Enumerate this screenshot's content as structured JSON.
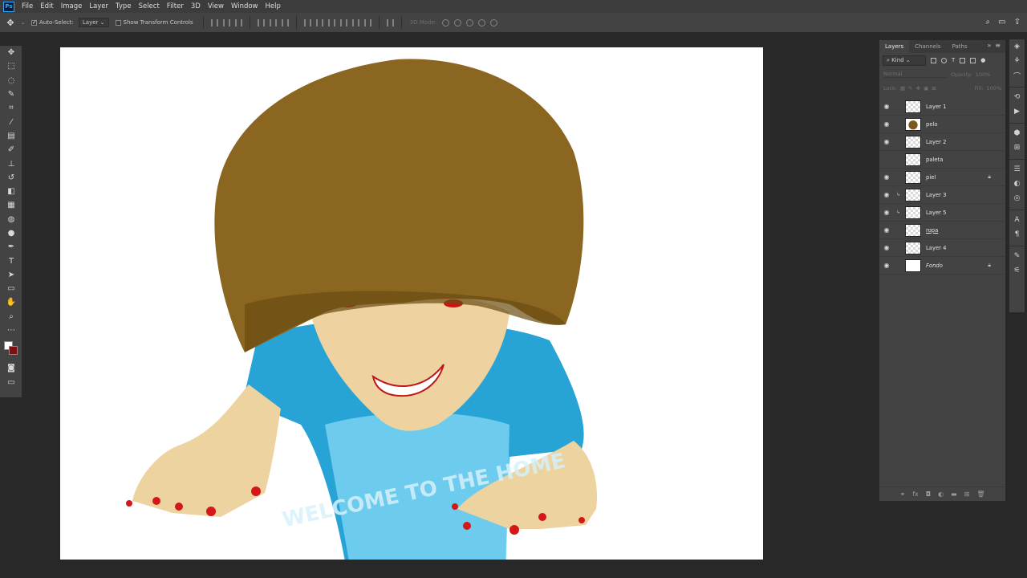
{
  "app": {
    "logo": "Ps"
  },
  "menu": [
    "File",
    "Edit",
    "Image",
    "Layer",
    "Type",
    "Select",
    "Filter",
    "3D",
    "View",
    "Window",
    "Help"
  ],
  "options": {
    "tool_icon": "move-icon",
    "auto_select_label": "Auto-Select:",
    "auto_select_checked": true,
    "auto_select_target": "Layer",
    "transform_controls_label": "Show Transform Controls",
    "mode_3d_label": "3D Mode:"
  },
  "tools": [
    "move-tool",
    "marquee-tool",
    "lasso-tool",
    "quick-selection-tool",
    "crop-tool",
    "eyedropper-tool",
    "healing-brush-tool",
    "brush-tool",
    "clone-stamp-tool",
    "history-brush-tool",
    "eraser-tool",
    "gradient-tool",
    "blur-tool",
    "dodge-tool",
    "pen-tool",
    "type-tool",
    "path-selection-tool",
    "rectangle-tool",
    "hand-tool",
    "zoom-tool",
    "edit-toolbar"
  ],
  "colors": {
    "foreground": "#ffffff",
    "background": "#7a1010",
    "canvas": "#ffffff",
    "hair": "#8a6620",
    "shirt": "#2aa6d6",
    "skin": "#edd3a0",
    "nails": "#d41818"
  },
  "artwork": {
    "shirt_text": "WELCOME TO THE HOME"
  },
  "layers_panel": {
    "tabs": [
      "Layers",
      "Channels",
      "Paths"
    ],
    "active_tab": "Layers",
    "filter_label": "Kind",
    "blend_mode": "Normal",
    "opacity_label": "Opacity:",
    "opacity_value": "100%",
    "lock_label": "Lock:",
    "fill_label": "Fill:",
    "fill_value": "100%",
    "layers": [
      {
        "name": "Layer 1",
        "visible": true,
        "clipped": false,
        "locked": false,
        "thumb": "transparent"
      },
      {
        "name": "pelo",
        "visible": true,
        "clipped": false,
        "locked": false,
        "thumb": "hair"
      },
      {
        "name": "Layer 2",
        "visible": true,
        "clipped": false,
        "locked": false,
        "thumb": "transparent"
      },
      {
        "name": "paleta",
        "visible": false,
        "clipped": false,
        "locked": false,
        "thumb": "transparent"
      },
      {
        "name": "piel",
        "visible": true,
        "clipped": false,
        "locked": true,
        "thumb": "transparent"
      },
      {
        "name": "Layer 3",
        "visible": true,
        "clipped": true,
        "locked": false,
        "thumb": "transparent"
      },
      {
        "name": "Layer 5",
        "visible": true,
        "clipped": true,
        "locked": false,
        "thumb": "transparent"
      },
      {
        "name": "ropa",
        "visible": true,
        "clipped": false,
        "locked": false,
        "thumb": "transparent"
      },
      {
        "name": "Layer 4",
        "visible": true,
        "clipped": false,
        "locked": false,
        "thumb": "transparent"
      },
      {
        "name": "Fondo",
        "visible": true,
        "clipped": false,
        "locked": true,
        "thumb": "white",
        "italic": true
      }
    ]
  }
}
